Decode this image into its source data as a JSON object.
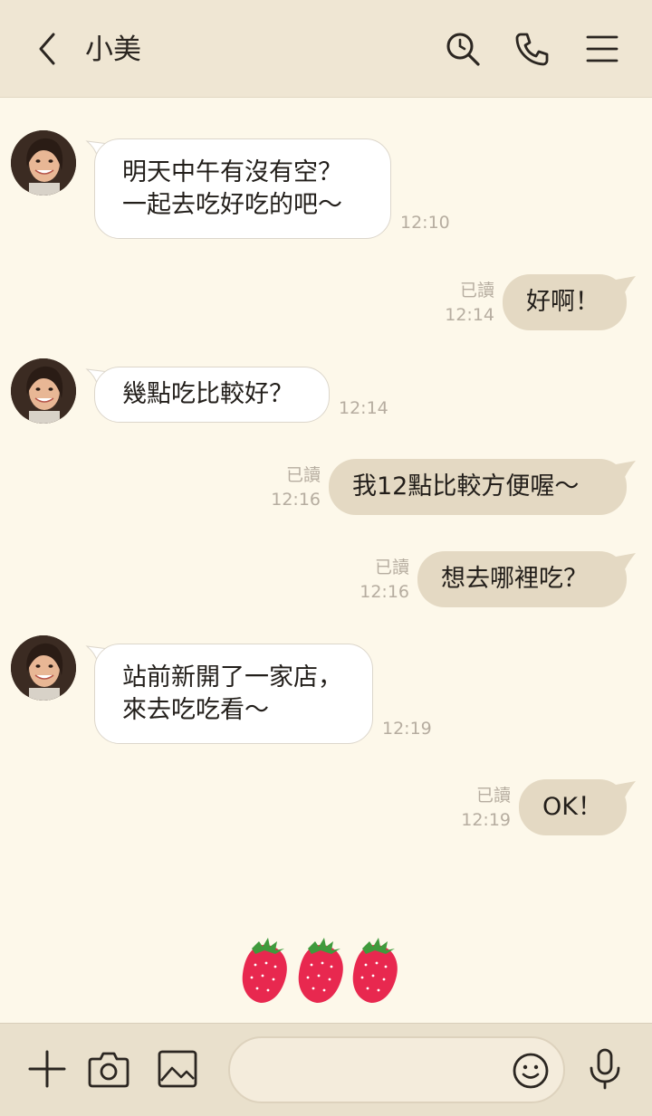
{
  "header": {
    "contact_name": "小美",
    "icons": [
      "back-chevron-icon",
      "search-icon",
      "phone-icon",
      "menu-icon"
    ]
  },
  "messages": [
    {
      "side": "in",
      "text": "明天中午有沒有空？\n一起去吃好吃的吧～",
      "time": "12:10"
    },
    {
      "side": "out",
      "text": "好啊！",
      "read": "已讀",
      "time": "12:14"
    },
    {
      "side": "in",
      "text": "幾點吃比較好？",
      "time": "12:14"
    },
    {
      "side": "out",
      "text": "我12點比較方便喔～",
      "read": "已讀",
      "time": "12:16"
    },
    {
      "side": "out",
      "text": "想去哪裡吃？",
      "read": "已讀",
      "time": "12:16"
    },
    {
      "side": "in",
      "text": "站前新開了一家店，\n來去吃吃看～",
      "time": "12:19"
    },
    {
      "side": "out",
      "text": "OK！",
      "read": "已讀",
      "time": "12:19"
    }
  ],
  "sticker": {
    "name": "strawberry-sticker",
    "count": 3
  },
  "composer": {
    "input_value": "",
    "icons": [
      "plus-icon",
      "camera-icon",
      "image-icon",
      "emoji-icon",
      "microphone-icon"
    ]
  },
  "colors": {
    "header_bg": "#efe6d3",
    "chat_bg": "#fdf8ea",
    "outgoing_bubble": "#e4d9c3",
    "incoming_bubble": "#ffffff",
    "composer_bg": "#e9e0cc",
    "strawberry": "#e8284f"
  }
}
